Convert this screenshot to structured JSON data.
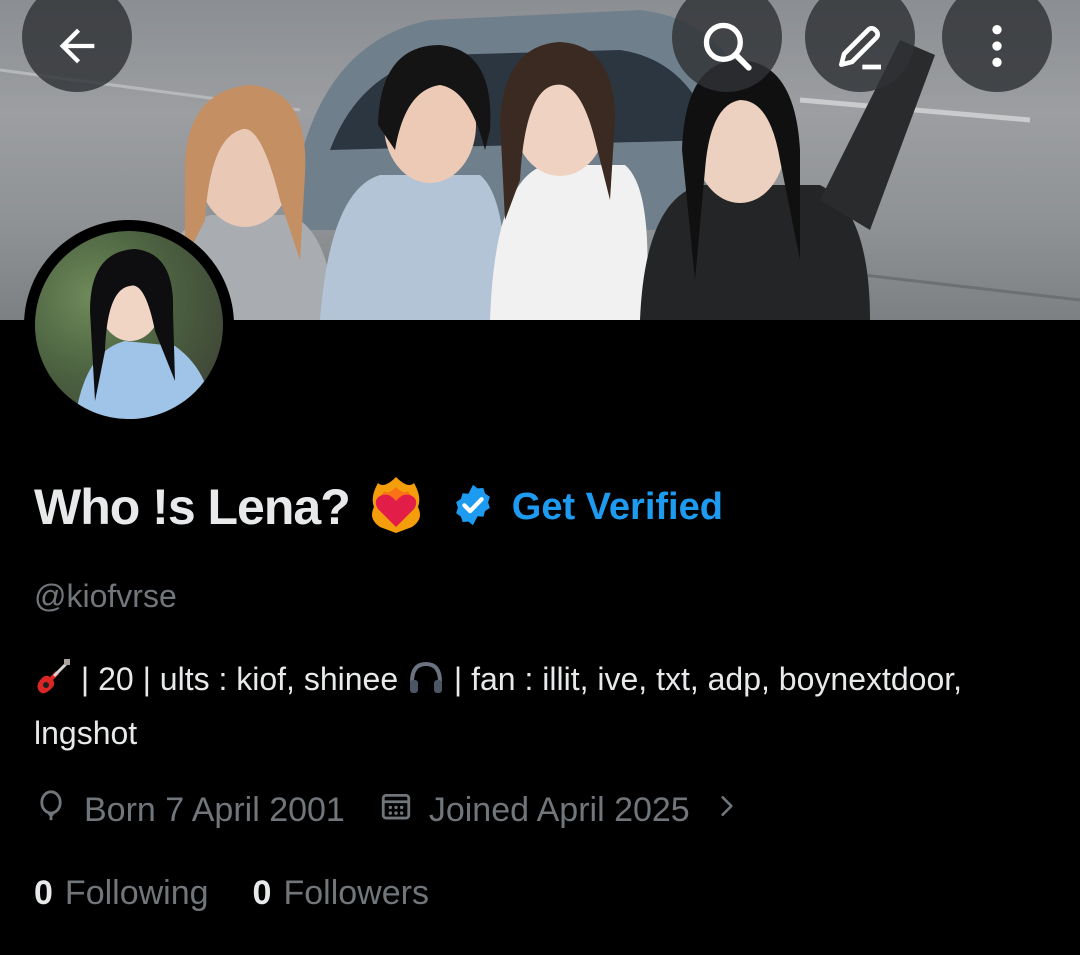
{
  "header": {
    "back_icon": "arrow-left-icon",
    "search_icon": "search-icon",
    "edit_icon": "pencil-icon",
    "more_icon": "more-vertical-icon"
  },
  "profile": {
    "display_name": "Who !s Lena?",
    "name_emoji": "heart-on-fire-emoji",
    "get_verified_label": "Get Verified",
    "handle": "@kiofvrse",
    "bio": {
      "part1": " | 20 | ults : kiof, shinee ",
      "part2": " | fan : illit, ive, txt, adp, boynextdoor, lngshot",
      "icon1": "guitar-emoji",
      "icon2": "headphones-emoji"
    },
    "birth": "Born 7 April 2001",
    "joined": "Joined April 2025",
    "following_count": "0",
    "following_label": "Following",
    "followers_count": "0",
    "followers_label": "Followers"
  },
  "colors": {
    "background": "#000000",
    "accent": "#1d9bf0",
    "secondary_text": "#71767b",
    "primary_text": "#e7e9ea"
  }
}
